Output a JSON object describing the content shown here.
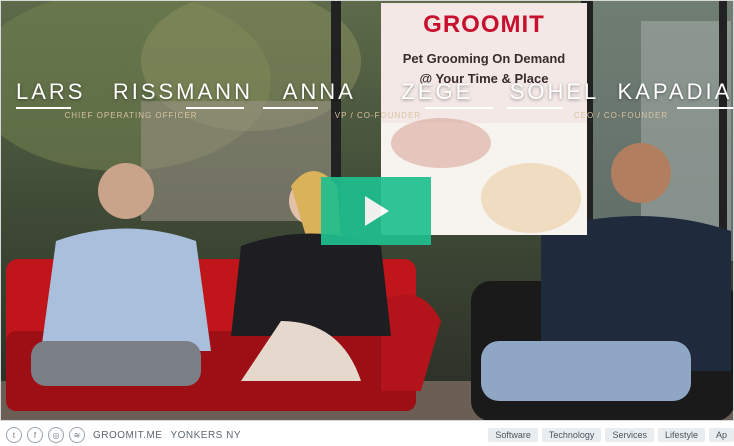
{
  "video": {
    "brand": "GROOMIT",
    "tagline_line1": "Pet Grooming On Demand",
    "tagline_line2": "@ Your Time & Place",
    "people": [
      {
        "first": "LARS",
        "last": "RISSMANN",
        "title": "CHIEF OPERATING OFFICER"
      },
      {
        "first": "ANNA",
        "last": "ZEGE",
        "title": "VP / CO-FOUNDER"
      },
      {
        "first": "SOHEL",
        "last": "KAPADIA",
        "title": "CEO / CO-FOUNDER"
      }
    ],
    "colors": {
      "play": "#1fbf8f",
      "brand": "#c8102e",
      "sofa": "#c0161b"
    }
  },
  "footer": {
    "social_icons": [
      "twitter-icon",
      "facebook-icon",
      "instagram-icon",
      "rss-icon"
    ],
    "site": "GROOMIT.ME",
    "location": "YONKERS NY",
    "tags": [
      "Software",
      "Technology",
      "Services",
      "Lifestyle",
      "Ap"
    ]
  }
}
